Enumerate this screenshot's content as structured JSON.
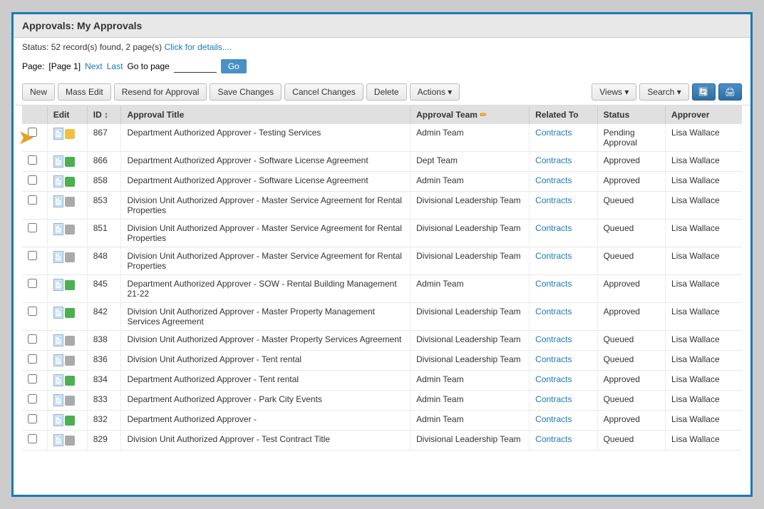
{
  "window": {
    "title": "Approvals: My Approvals"
  },
  "status": {
    "text": "Status: 52 record(s) found, 2 page(s)",
    "link_text": "Click for details...."
  },
  "pagination": {
    "label": "Page:",
    "current_page": "[Page 1]",
    "next_label": "Next",
    "last_label": "Last",
    "go_to_label": "Go to page",
    "go_button_label": "Go"
  },
  "toolbar": {
    "new_label": "New",
    "mass_edit_label": "Mass Edit",
    "resend_label": "Resend for Approval",
    "save_label": "Save Changes",
    "cancel_label": "Cancel Changes",
    "delete_label": "Delete",
    "actions_label": "Actions",
    "views_label": "Views",
    "search_label": "Search"
  },
  "table": {
    "columns": [
      "Edit",
      "ID",
      "Approval Title",
      "Approval Team",
      "Related To",
      "Status",
      "Approver"
    ],
    "rows": [
      {
        "id": "867",
        "title": "Department Authorized Approver - Testing Services",
        "approval_team": "Admin Team",
        "related_to": "Contracts",
        "status": "Pending Approval",
        "approver": "Lisa Wallace",
        "indicator_color": "yellow"
      },
      {
        "id": "866",
        "title": "Department Authorized Approver - Software License Agreement",
        "approval_team": "Dept Team",
        "related_to": "Contracts",
        "status": "Approved",
        "approver": "Lisa Wallace",
        "indicator_color": "green"
      },
      {
        "id": "858",
        "title": "Department Authorized Approver - Software License Agreement",
        "approval_team": "Admin Team",
        "related_to": "Contracts",
        "status": "Approved",
        "approver": "Lisa Wallace",
        "indicator_color": "green"
      },
      {
        "id": "853",
        "title": "Division Unit Authorized Approver - Master Service Agreement for Rental Properties",
        "approval_team": "Divisional Leadership Team",
        "related_to": "Contracts",
        "status": "Queued",
        "approver": "Lisa Wallace",
        "indicator_color": "gray"
      },
      {
        "id": "851",
        "title": "Division Unit Authorized Approver - Master Service Agreement for Rental Properties",
        "approval_team": "Divisional Leadership Team",
        "related_to": "Contracts",
        "status": "Queued",
        "approver": "Lisa Wallace",
        "indicator_color": "gray"
      },
      {
        "id": "848",
        "title": "Division Unit Authorized Approver - Master Service Agreement for Rental Properties",
        "approval_team": "Divisional Leadership Team",
        "related_to": "Contracts",
        "status": "Queued",
        "approver": "Lisa Wallace",
        "indicator_color": "gray"
      },
      {
        "id": "845",
        "title": "Department Authorized Approver - SOW - Rental Building Management 21-22",
        "approval_team": "Admin Team",
        "related_to": "Contracts",
        "status": "Approved",
        "approver": "Lisa Wallace",
        "indicator_color": "green"
      },
      {
        "id": "842",
        "title": "Division Unit Authorized Approver - Master Property Management Services Agreement",
        "approval_team": "Divisional Leadership Team",
        "related_to": "Contracts",
        "status": "Approved",
        "approver": "Lisa Wallace",
        "indicator_color": "green"
      },
      {
        "id": "838",
        "title": "Division Unit Authorized Approver - Master Property Services Agreement",
        "approval_team": "Divisional Leadership Team",
        "related_to": "Contracts",
        "status": "Queued",
        "approver": "Lisa Wallace",
        "indicator_color": "gray"
      },
      {
        "id": "836",
        "title": "Division Unit Authorized Approver - Tent rental",
        "approval_team": "Divisional Leadership Team",
        "related_to": "Contracts",
        "status": "Queued",
        "approver": "Lisa Wallace",
        "indicator_color": "gray"
      },
      {
        "id": "834",
        "title": "Department Authorized Approver - Tent rental",
        "approval_team": "Admin Team",
        "related_to": "Contracts",
        "status": "Approved",
        "approver": "Lisa Wallace",
        "indicator_color": "green"
      },
      {
        "id": "833",
        "title": "Department Authorized Approver - Park City Events",
        "approval_team": "Admin Team",
        "related_to": "Contracts",
        "status": "Queued",
        "approver": "Lisa Wallace",
        "indicator_color": "gray"
      },
      {
        "id": "832",
        "title": "Department Authorized Approver -",
        "approval_team": "Admin Team",
        "related_to": "Contracts",
        "status": "Approved",
        "approver": "Lisa Wallace",
        "indicator_color": "green"
      },
      {
        "id": "829",
        "title": "Division Unit Authorized Approver - Test Contract Title",
        "approval_team": "Divisional Leadership Team",
        "related_to": "Contracts",
        "status": "Queued",
        "approver": "Lisa Wallace",
        "indicator_color": "gray"
      }
    ]
  }
}
